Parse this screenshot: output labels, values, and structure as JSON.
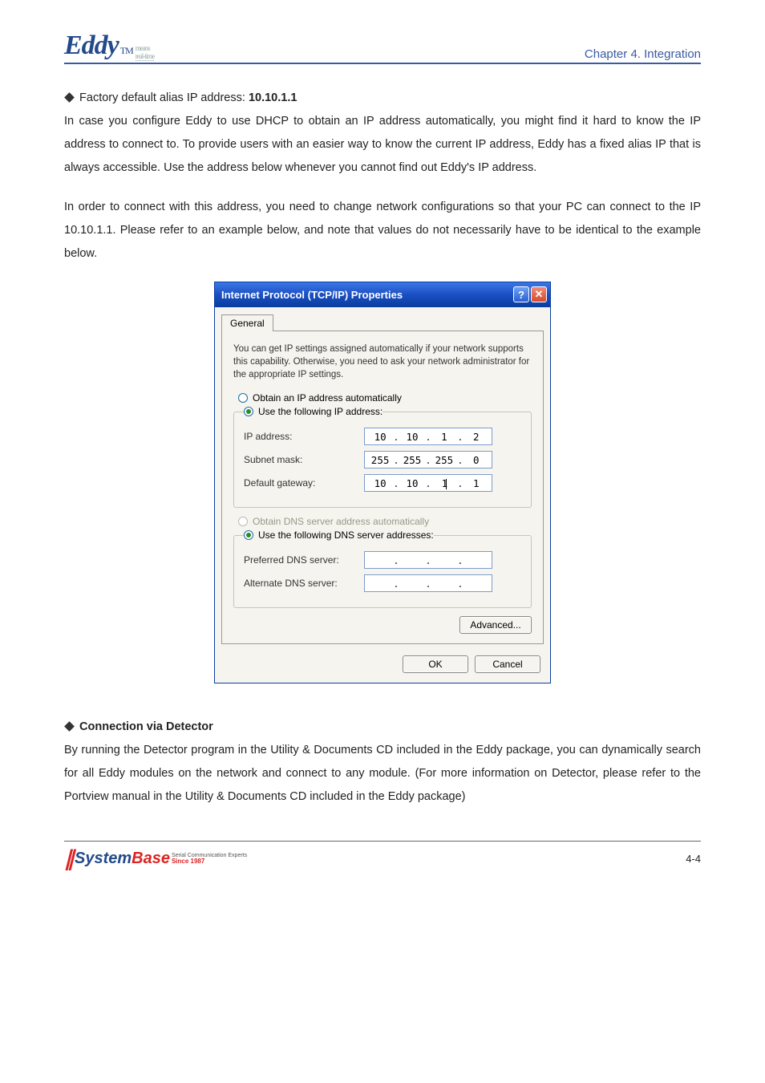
{
  "header": {
    "logo_text": "Eddy",
    "logo_tm": "TM",
    "logo_sub1": "means",
    "logo_sub2": "real-time",
    "chapter": "Chapter 4. Integration"
  },
  "section1": {
    "heading_prefix": "Factory default alias IP address: ",
    "heading_bold": "10.10.1.1",
    "para1": "In case you configure Eddy to use DHCP to obtain an IP address automatically, you might find it hard to know the IP address to connect to. To provide users with an easier way to know the current IP address, Eddy has a fixed alias IP that is always accessible. Use the address below whenever you cannot find out Eddy's IP address.",
    "para2": "In order to connect with this address, you need to change network configurations so that your PC can connect to the IP 10.10.1.1. Please refer to an example below, and note that values do not necessarily have to be identical to the example below."
  },
  "dialog": {
    "title": "Internet Protocol (TCP/IP) Properties",
    "help": "?",
    "close": "✕",
    "tab": "General",
    "intro": "You can get IP settings assigned automatically if your network supports this capability. Otherwise, you need to ask your network administrator for the appropriate IP settings.",
    "radio_obtain_ip": "Obtain an IP address automatically",
    "radio_use_ip": "Use the following IP address:",
    "ip_label": "IP address:",
    "ip_value": [
      "10",
      "10",
      "1",
      "2"
    ],
    "subnet_label": "Subnet mask:",
    "subnet_value": [
      "255",
      "255",
      "255",
      "0"
    ],
    "gateway_label": "Default gateway:",
    "gateway_value": [
      "10",
      "10",
      "1",
      "1"
    ],
    "radio_obtain_dns": "Obtain DNS server address automatically",
    "radio_use_dns": "Use the following DNS server addresses:",
    "pref_dns_label": "Preferred DNS server:",
    "alt_dns_label": "Alternate DNS server:",
    "advanced": "Advanced...",
    "ok": "OK",
    "cancel": "Cancel"
  },
  "section2": {
    "heading": "Connection via Detector",
    "para": "By running the Detector program in the Utility & Documents CD included in the Eddy package, you can dynamically search for all Eddy modules on the network and connect to any module. (For more information on Detector, please refer to the Portview manual in the Utility & Documents CD included in the Eddy package)"
  },
  "footer": {
    "experts": "Serial Communication Experts",
    "system": "System",
    "base": "Base",
    "since": "Since 1987",
    "page": "4-4"
  }
}
